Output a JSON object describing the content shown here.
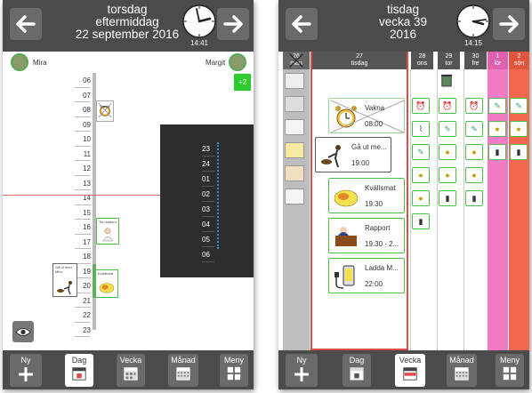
{
  "left": {
    "header": {
      "line1": "torsdag",
      "line2": "eftermiddag",
      "line3": "22 september 2016",
      "clock_time": "14:41"
    },
    "persons": {
      "left_name": "Mira",
      "right_name": "Margit"
    },
    "more_badge": "+2",
    "hours": [
      "06",
      "07",
      "08",
      "09",
      "10",
      "11",
      "12",
      "13",
      "14",
      "15",
      "16",
      "17",
      "18",
      "19",
      "20",
      "21",
      "22",
      "23"
    ],
    "dark_hours": [
      "23",
      "24",
      "01",
      "02",
      "03",
      "04",
      "05",
      "06"
    ],
    "events": {
      "vakna": "Vakna",
      "tid_doktorn": "Tid doktorn",
      "ga_ut": "Gå ut med Mira",
      "kvallsmat": "Kvällsmat"
    }
  },
  "right": {
    "header": {
      "line1": "tisdag",
      "line2": "vecka 39",
      "line3": "2016",
      "clock_time": "14:15"
    },
    "days": [
      {
        "num": "26",
        "name": "mån"
      },
      {
        "num": "27",
        "name": "tisdag"
      },
      {
        "num": "28",
        "name": "ons"
      },
      {
        "num": "29",
        "name": "tor"
      },
      {
        "num": "30",
        "name": "fre"
      },
      {
        "num": "1",
        "name": "lör"
      },
      {
        "num": "2",
        "name": "sön"
      }
    ],
    "cards": [
      {
        "title": "Vakna",
        "time": "08:00"
      },
      {
        "title": "Gå ut me...",
        "time": "19:00"
      },
      {
        "title": "Kvällsmat",
        "time": "19:30"
      },
      {
        "title": "Rapport",
        "time": "19:30 - 2..."
      },
      {
        "title": "Ladda M...",
        "time": "22:00"
      }
    ]
  },
  "nav": {
    "left": {
      "new": "Ny",
      "day": "Dag",
      "week": "Vecka",
      "month": "Månad",
      "menu": "Meny"
    },
    "right": {
      "new": "Ny",
      "day": "Dag",
      "week": "Vecka",
      "month": "Månad",
      "menu": "Meny"
    }
  },
  "colors": {
    "bar": "#4b4b4b",
    "green_frame": "#4ac04a",
    "saturday": "#f37bc6",
    "sunday": "#f3674f",
    "today_frame": "#e34a4a"
  }
}
